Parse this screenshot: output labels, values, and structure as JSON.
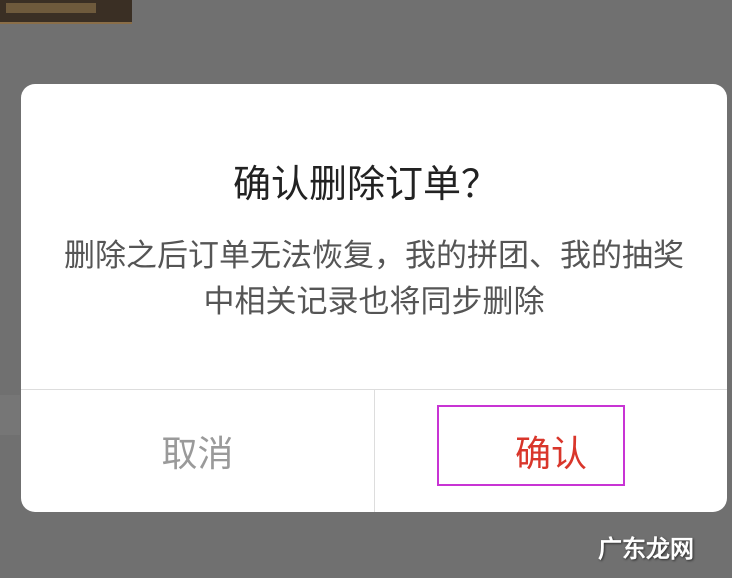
{
  "dialog": {
    "title": "确认删除订单？",
    "message": "删除之后订单无法恢复，我的拼团、我的抽奖中相关记录也将同步删除",
    "cancel_label": "取消",
    "confirm_label": "确认"
  },
  "watermark": {
    "text": "广东龙网"
  },
  "colors": {
    "overlay": "#6f6f6f",
    "dialog_background": "#ffffff",
    "title_text": "#222222",
    "message_text": "#555555",
    "cancel_text": "#9a9a9a",
    "confirm_text": "#d9362b",
    "highlight_border": "#c834d4"
  }
}
